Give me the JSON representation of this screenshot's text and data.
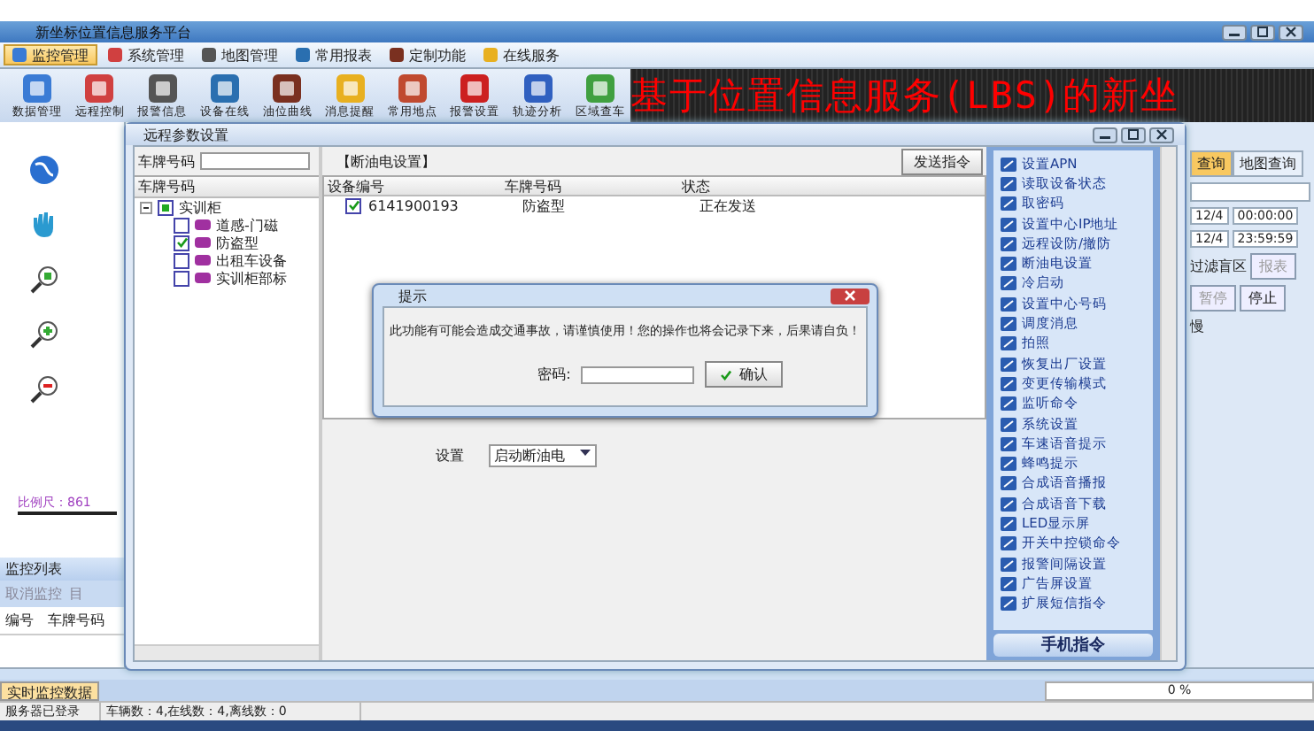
{
  "window": {
    "title": "新坐标位置信息服务平台"
  },
  "menu": [
    {
      "label": "监控管理",
      "selected": true
    },
    {
      "label": "系统管理",
      "selected": false
    },
    {
      "label": "地图管理",
      "selected": false
    },
    {
      "label": "常用报表",
      "selected": false
    },
    {
      "label": "定制功能",
      "selected": false
    },
    {
      "label": "在线服务",
      "selected": false
    }
  ],
  "toolbar": [
    "数据管理",
    "远程控制",
    "报警信息",
    "设备在线",
    "油位曲线",
    "消息提醒",
    "常用地点",
    "报警设置",
    "轨迹分析",
    "区域查车"
  ],
  "banner": "基于位置信息服务(LBS)的新坐",
  "scale": "比例尺：861",
  "monitor_list": {
    "title": "监控列表",
    "actions": [
      "取消监控",
      "目"
    ],
    "columns": [
      "编号",
      "车牌号码"
    ]
  },
  "query_panel": {
    "tabs": [
      {
        "label": "查询",
        "selected": true
      },
      {
        "label": "地图查询",
        "selected": false
      }
    ],
    "start_date": "12/4",
    "start_time": "00:00:00",
    "end_date": "12/4",
    "end_time": "23:59:59",
    "filter_label": "过滤盲区",
    "report_button": "报表",
    "pause_button": "暂停",
    "stop_button": "停止",
    "note": "慢"
  },
  "bottom_tabs": [
    {
      "label": "实时监控数据",
      "selected": true
    }
  ],
  "status_bar": [
    "服务器已登录",
    "车辆数：4,在线数：4,离线数：0"
  ],
  "progress": {
    "reading": "0 %",
    "level": 0
  },
  "param_dialog": {
    "title": "远程参数设置",
    "plate_label": "车牌号码",
    "tree_header": "车牌号码",
    "tree": [
      {
        "label": "实训柜",
        "expanded": true,
        "partial": true,
        "children": [
          {
            "label": "道感-门磁",
            "checked": false
          },
          {
            "label": "防盗型",
            "checked": true
          },
          {
            "label": "出租车设备",
            "checked": false
          },
          {
            "label": "实训柜部标",
            "checked": false
          }
        ]
      }
    ],
    "section_title": "【断油电设置】",
    "send_button": "发送指令",
    "columns": [
      "设备编号",
      "车牌号码",
      "状态"
    ],
    "rows": [
      {
        "checked": true,
        "cells": [
          "6141900193",
          "防盗型",
          "正在发送"
        ]
      }
    ],
    "setting_label": "设置",
    "setting_value": "启动断油电",
    "commands": [
      "设置APN",
      "读取设备状态",
      "取密码",
      "设置中心IP地址",
      "远程设防/撤防",
      "断油电设置",
      "冷启动",
      "设置中心号码",
      "调度消息",
      "拍照",
      "恢复出厂设置",
      "变更传输模式",
      "监听命令",
      "系统设置",
      "车速语音提示",
      "蜂鸣提示",
      "合成语音播报",
      "合成语音下载",
      "LED显示屏",
      "开关中控锁命令",
      "报警间隔设置",
      "广告屏设置",
      "扩展短信指令"
    ],
    "command_group": "手机指令"
  },
  "prompt": {
    "title": "提示",
    "message": "此功能有可能会造成交通事故，请谨慎使用！您的操作也将会记录下来，后果请自负！",
    "password_label": "密码:",
    "confirm_button": "确认"
  }
}
